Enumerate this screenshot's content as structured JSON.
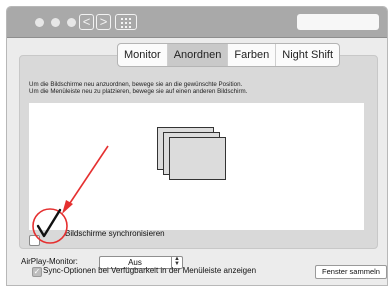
{
  "toolbar": {
    "back_label": "<",
    "forward_label": ">"
  },
  "tabs": [
    {
      "label": "Monitor"
    },
    {
      "label": "Anordnen"
    },
    {
      "label": "Farben"
    },
    {
      "label": "Night Shift"
    }
  ],
  "arrange": {
    "instruction_1": "Um die Bildschirme neu anzuordnen, bewege sie an die gewünschte Position.",
    "instruction_2": "Um die Menüleiste neu zu platzieren, bewege sie auf einen anderen Bildschirm.",
    "mirror_label": "Bildschirme synchronisieren",
    "mirror_checked": true
  },
  "airplay": {
    "label": "AirPlay-Monitor:",
    "value": "Aus"
  },
  "footer": {
    "sync_options_label": "Sync-Optionen bei Verfügbarkeit in der Menüleiste anzeigen",
    "sync_options_checked": true,
    "gather_button_label": "Fenster sammeln"
  },
  "annotation": {
    "color": "#e53030"
  }
}
